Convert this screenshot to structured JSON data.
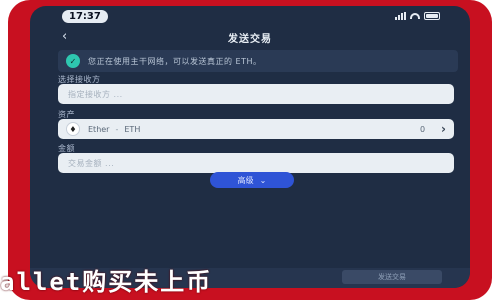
{
  "status_bar": {
    "time": "17:37"
  },
  "nav": {
    "title": "发送交易"
  },
  "notice": {
    "icon": "check-icon",
    "text": "您正在使用主干网络，可以发送真正的 ETH。"
  },
  "form": {
    "recipient_label": "选择接收方",
    "recipient_placeholder": "指定接收方 ...",
    "asset_label": "资产",
    "asset_name": "Ether",
    "asset_separator": "-",
    "asset_symbol": "ETH",
    "asset_balance": "0",
    "amount_label": "金额",
    "amount_placeholder": "交易金额 ..."
  },
  "advanced": {
    "label": "高级"
  },
  "confirm": {
    "label": "发送交易"
  },
  "banner": {
    "text": "allet购买未上币"
  },
  "colors": {
    "frame": "#c81020",
    "screen": "#1f2d44",
    "accent": "#2f54d6",
    "success": "#2ec7b0"
  }
}
